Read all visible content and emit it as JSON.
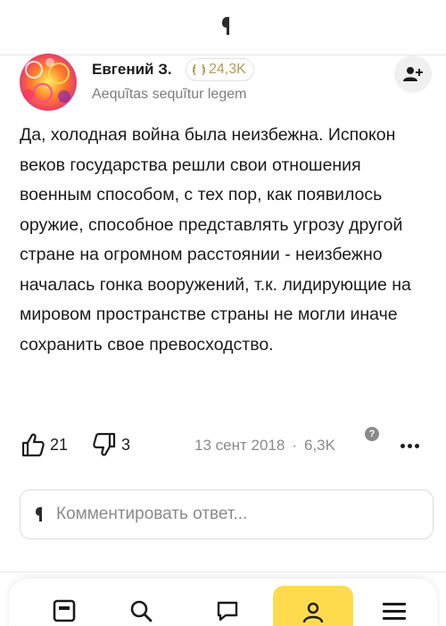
{
  "author": {
    "name": "Евгений З.",
    "rating": "24,3K",
    "bio": "Aequĩtas sequĩtur legem"
  },
  "answer": {
    "text": "Да, холодная война была неизбежна. Испокон веков государства решли свои отношения военным способом, с тех пор, как появилось оружие, способное представлять угрозу другой стране на огромном расстоянии - неизбежно началась гонка вооружений, т.к. лидирующие на мировом пространстве страны не могли иначе сохранить свое превосходство."
  },
  "actions": {
    "likes": "21",
    "dislikes": "3",
    "date": "13 сент 2018",
    "separator": "·",
    "views": "6,3K",
    "views_help": "?"
  },
  "comment": {
    "placeholder": "Комментировать ответ..."
  },
  "colors": {
    "accent_yellow": "#ffdb4d",
    "rating_gold": "#b59a57",
    "muted_text": "#8a8a8a"
  },
  "bottom_nav": {
    "items": [
      "feed-icon",
      "search-icon",
      "chat-icon",
      "profile-icon",
      "menu-icon"
    ],
    "active": "profile-icon"
  }
}
